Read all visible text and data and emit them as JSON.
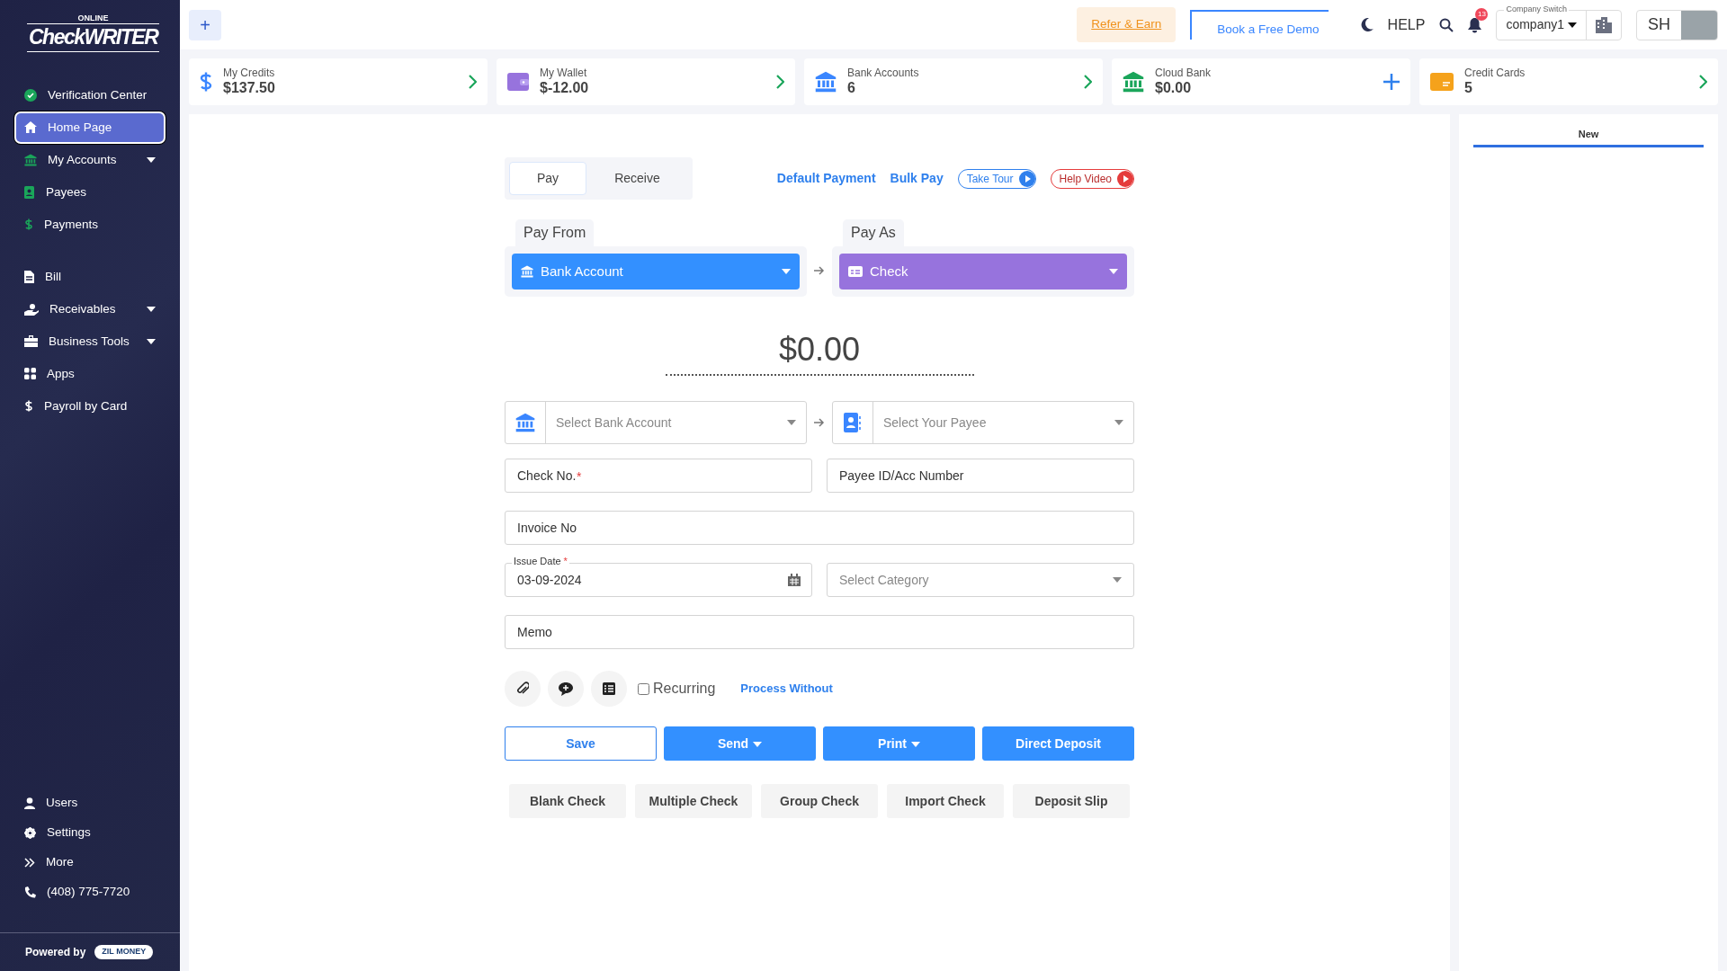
{
  "logo": {
    "small": "ONLINE",
    "main": "CheckWRITER"
  },
  "sidebar": {
    "items": [
      {
        "label": "Verification Center",
        "selected": false
      },
      {
        "label": "Home Page",
        "selected": true
      },
      {
        "label": "My Accounts",
        "selected": false,
        "expanded": false
      },
      {
        "label": "Payees",
        "selected": false
      },
      {
        "label": "Payments",
        "selected": false
      }
    ],
    "tool_items": [
      {
        "label": "Bill",
        "selected": false
      },
      {
        "label": "Receivables",
        "selected": false,
        "expanded": false
      },
      {
        "label": "Business Tools",
        "selected": false,
        "expanded": false
      },
      {
        "label": "Apps",
        "selected": false
      },
      {
        "label": "Payroll by Card",
        "selected": false
      }
    ],
    "bottom_items": [
      "Users",
      "Settings",
      "More",
      "(408) 775-7720"
    ],
    "powered_by": "Powered by",
    "brand_badge": "ZIL MONEY"
  },
  "topbar": {
    "add_button": "+",
    "refer": "Refer & Earn",
    "demo": "Book a Free Demo",
    "help": "HELP",
    "notification_count": "13",
    "company_label": "Company Switch",
    "company": "company1",
    "user_initials": "SH"
  },
  "stats": [
    {
      "label": "My Credits",
      "value": "$137.50",
      "kind": "link"
    },
    {
      "label": "My Wallet",
      "value": "$-12.00",
      "kind": "link"
    },
    {
      "label": "Bank Accounts",
      "value": "6",
      "kind": "link"
    },
    {
      "label": "Cloud Bank",
      "value": "$0.00",
      "kind": "add"
    },
    {
      "label": "Credit Cards",
      "value": "5",
      "kind": "link"
    }
  ],
  "payment": {
    "tabs": [
      {
        "label": "Pay",
        "selected": true
      },
      {
        "label": "Receive",
        "selected": false
      }
    ],
    "links": [
      "Default Payment",
      "Bulk Pay"
    ],
    "take_tour": "Take Tour",
    "help_video": "Help Video",
    "pay_from": {
      "label": "Pay From",
      "value": "Bank Account"
    },
    "pay_as": {
      "label": "Pay As",
      "value": "Check"
    },
    "amount": "$0.00",
    "bank_select": {
      "placeholder": "Select Bank Account"
    },
    "payee_select": {
      "placeholder": "Select Your Payee"
    },
    "check_no": {
      "placeholder": "Check No.",
      "required_mark": "*"
    },
    "payee_id": {
      "placeholder": "Payee ID/Acc Number"
    },
    "invoice": {
      "placeholder": "Invoice No"
    },
    "issue_date": {
      "label": "Issue Date",
      "required_mark": "*",
      "value": "03-09-2024"
    },
    "category": {
      "placeholder": "Select Category"
    },
    "memo": {
      "placeholder": "Memo"
    },
    "recurring": {
      "label": "Recurring",
      "checked": false
    },
    "process_without": "Process Without",
    "actions": [
      {
        "label": "Save",
        "kind": "outline",
        "caret": false
      },
      {
        "label": "Send",
        "kind": "solid",
        "caret": true
      },
      {
        "label": "Print",
        "kind": "solid",
        "caret": true
      },
      {
        "label": "Direct Deposit",
        "kind": "solid",
        "caret": false
      }
    ],
    "shortcuts": [
      "Blank Check",
      "Multiple Check",
      "Group Check",
      "Import Check",
      "Deposit Slip"
    ]
  },
  "side_panel": {
    "tabs": [
      {
        "label": "New",
        "selected": true
      }
    ]
  }
}
